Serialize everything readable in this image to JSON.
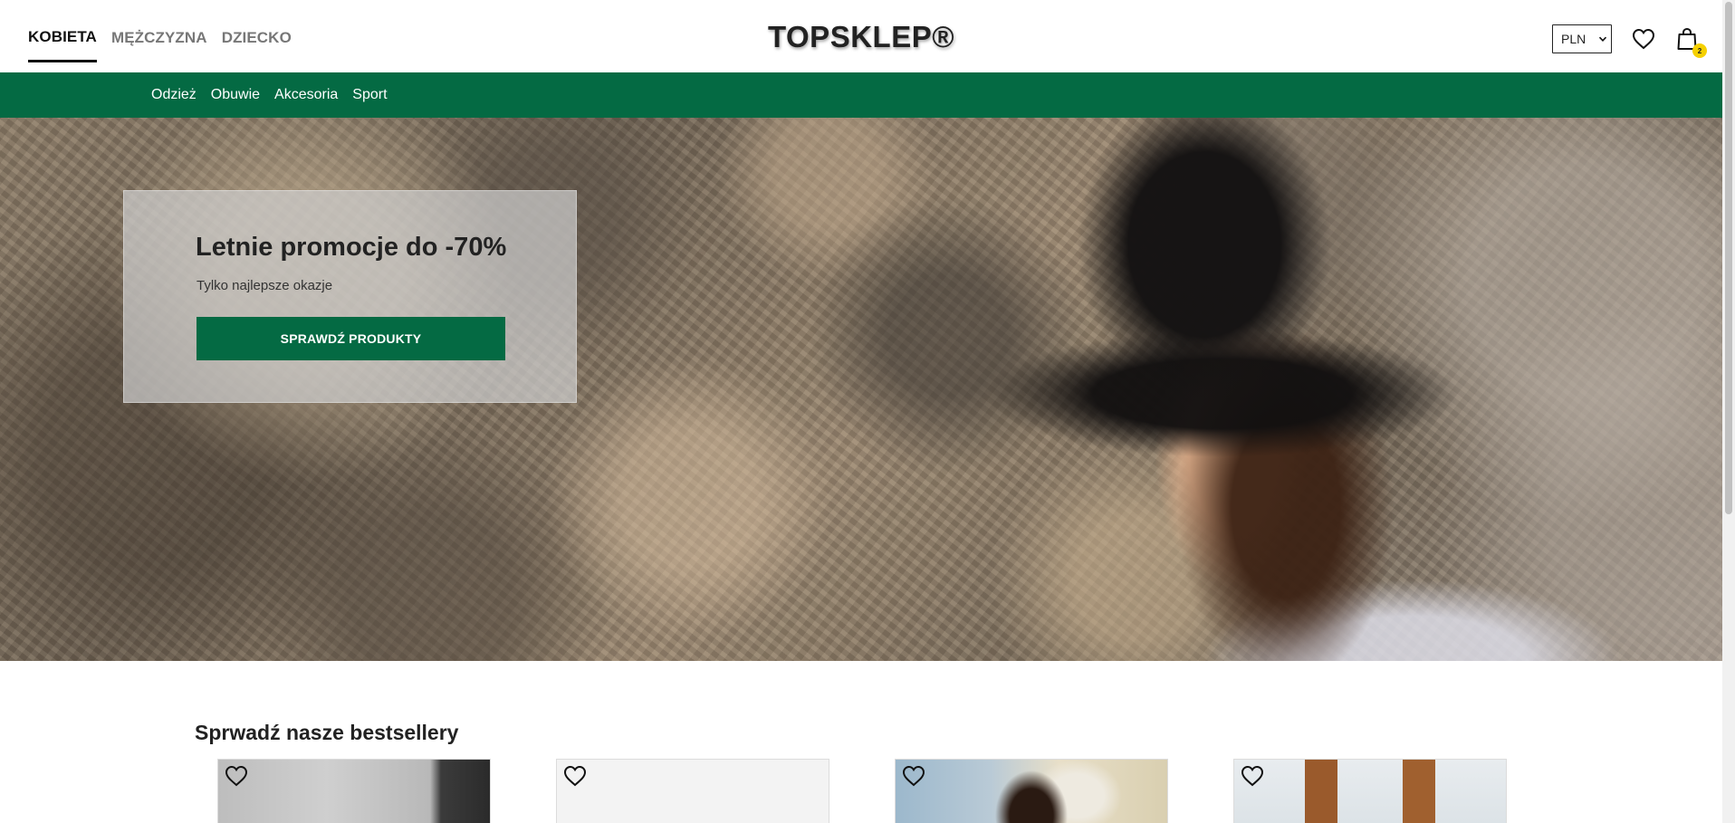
{
  "header": {
    "gender_tabs": [
      {
        "label": "KOBIETA",
        "active": true
      },
      {
        "label": "MĘŻCZYZNA",
        "active": false
      },
      {
        "label": "DZIECKO",
        "active": false
      }
    ],
    "logo": "TOPSKLEP®",
    "currency": {
      "selected": "PLN"
    },
    "icons": {
      "wishlist": "heart-icon",
      "cart": "shopping-bag-icon"
    },
    "cart_count": "2"
  },
  "categories": [
    "Odzież",
    "Obuwie",
    "Akcesoria",
    "Sport"
  ],
  "hero": {
    "title": "Letnie promocje do -70%",
    "subtitle": "Tylko najlepsze okazje",
    "button_label": "SPRAWDŹ PRODUKTY"
  },
  "bestsellers": {
    "title": "Sprwadź nasze bestsellery",
    "products": [
      {
        "fav_icon": "heart-icon"
      },
      {
        "fav_icon": "heart-icon"
      },
      {
        "fav_icon": "heart-icon"
      },
      {
        "fav_icon": "heart-icon"
      }
    ]
  },
  "colors": {
    "brand_green": "#046a43",
    "badge_yellow": "#f5d000"
  }
}
